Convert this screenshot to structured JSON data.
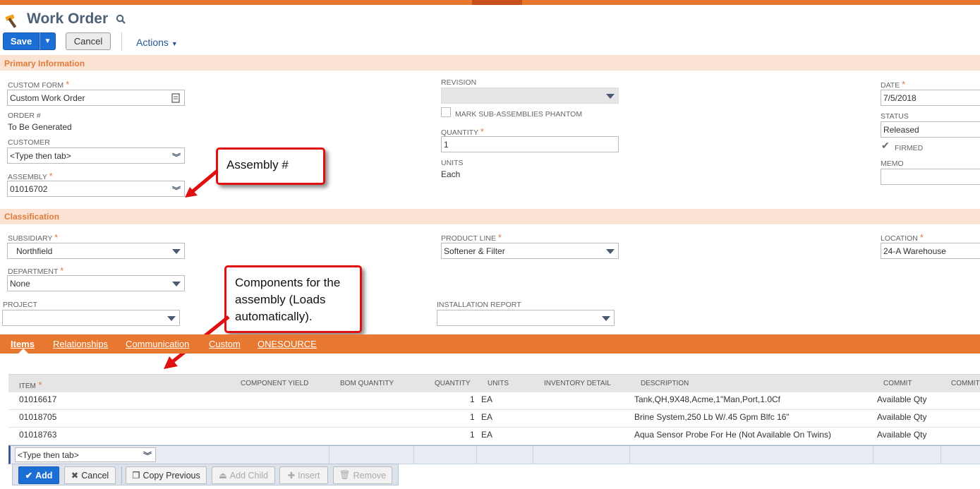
{
  "header": {
    "title": "Work Order",
    "save_label": "Save",
    "cancel_label": "Cancel",
    "actions_label": "Actions"
  },
  "primary": {
    "section_title": "Primary Information",
    "custom_form": {
      "label": "CUSTOM FORM",
      "value": "Custom Work Order"
    },
    "order_no": {
      "label": "ORDER #",
      "value": "To Be Generated"
    },
    "customer": {
      "label": "CUSTOMER",
      "value": "<Type then tab>"
    },
    "assembly": {
      "label": "ASSEMBLY",
      "value": "01016702"
    },
    "revision": {
      "label": "REVISION",
      "value": ""
    },
    "phantom": {
      "label": "MARK SUB-ASSEMBLIES PHANTOM",
      "checked": false
    },
    "quantity": {
      "label": "QUANTITY",
      "value": "1"
    },
    "units": {
      "label": "UNITS",
      "value": "Each"
    },
    "date": {
      "label": "DATE",
      "value": "7/5/2018"
    },
    "status": {
      "label": "STATUS",
      "value": "Released"
    },
    "firmed": {
      "label": "FIRMED",
      "checked": true
    },
    "memo": {
      "label": "MEMO",
      "value": ""
    }
  },
  "classification": {
    "section_title": "Classification",
    "subsidiary": {
      "label": "SUBSIDIARY",
      "value": "Northfield"
    },
    "department": {
      "label": "DEPARTMENT",
      "value": "None"
    },
    "project": {
      "label": "PROJECT",
      "value": ""
    },
    "product_line": {
      "label": "PRODUCT LINE",
      "value": "Softener & Filter"
    },
    "installation_report": {
      "label": "INSTALLATION REPORT",
      "value": ""
    },
    "location": {
      "label": "LOCATION",
      "value": "24-A Warehouse"
    }
  },
  "callouts": {
    "assembly": "Assembly #",
    "components": [
      "Components for the",
      "assembly (Loads",
      "automatically)."
    ]
  },
  "tabs": [
    "Items",
    "Relationships",
    "Communication",
    "Custom",
    "ONESOURCE"
  ],
  "grid": {
    "headers": {
      "item": "ITEM",
      "component_yield": "COMPONENT YIELD",
      "bom_quantity": "BOM QUANTITY",
      "quantity": "QUANTITY",
      "units": "UNITS",
      "inventory_detail": "INVENTORY DETAIL",
      "description": "DESCRIPTION",
      "commit": "COMMIT",
      "commitment": "COMMITI"
    },
    "rows": [
      {
        "item": "01016617",
        "quantity": "1",
        "units": "EA",
        "description": "Tank,QH,9X48,Acme,1\"Man,Port,1.0Cf",
        "commit": "Available Qty"
      },
      {
        "item": "01018705",
        "quantity": "1",
        "units": "EA",
        "description": "Brine System,250 Lb W/.45 Gpm Blfc 16\"",
        "commit": "Available Qty"
      },
      {
        "item": "01018763",
        "quantity": "1",
        "units": "EA",
        "description": "Aqua Sensor Probe For He (Not Available On Twins)",
        "commit": "Available Qty"
      }
    ],
    "new_item_placeholder": "<Type then tab>"
  },
  "row_buttons": {
    "add": "Add",
    "cancel": "Cancel",
    "copy_previous": "Copy Previous",
    "add_child": "Add Child",
    "insert": "Insert",
    "remove": "Remove"
  }
}
